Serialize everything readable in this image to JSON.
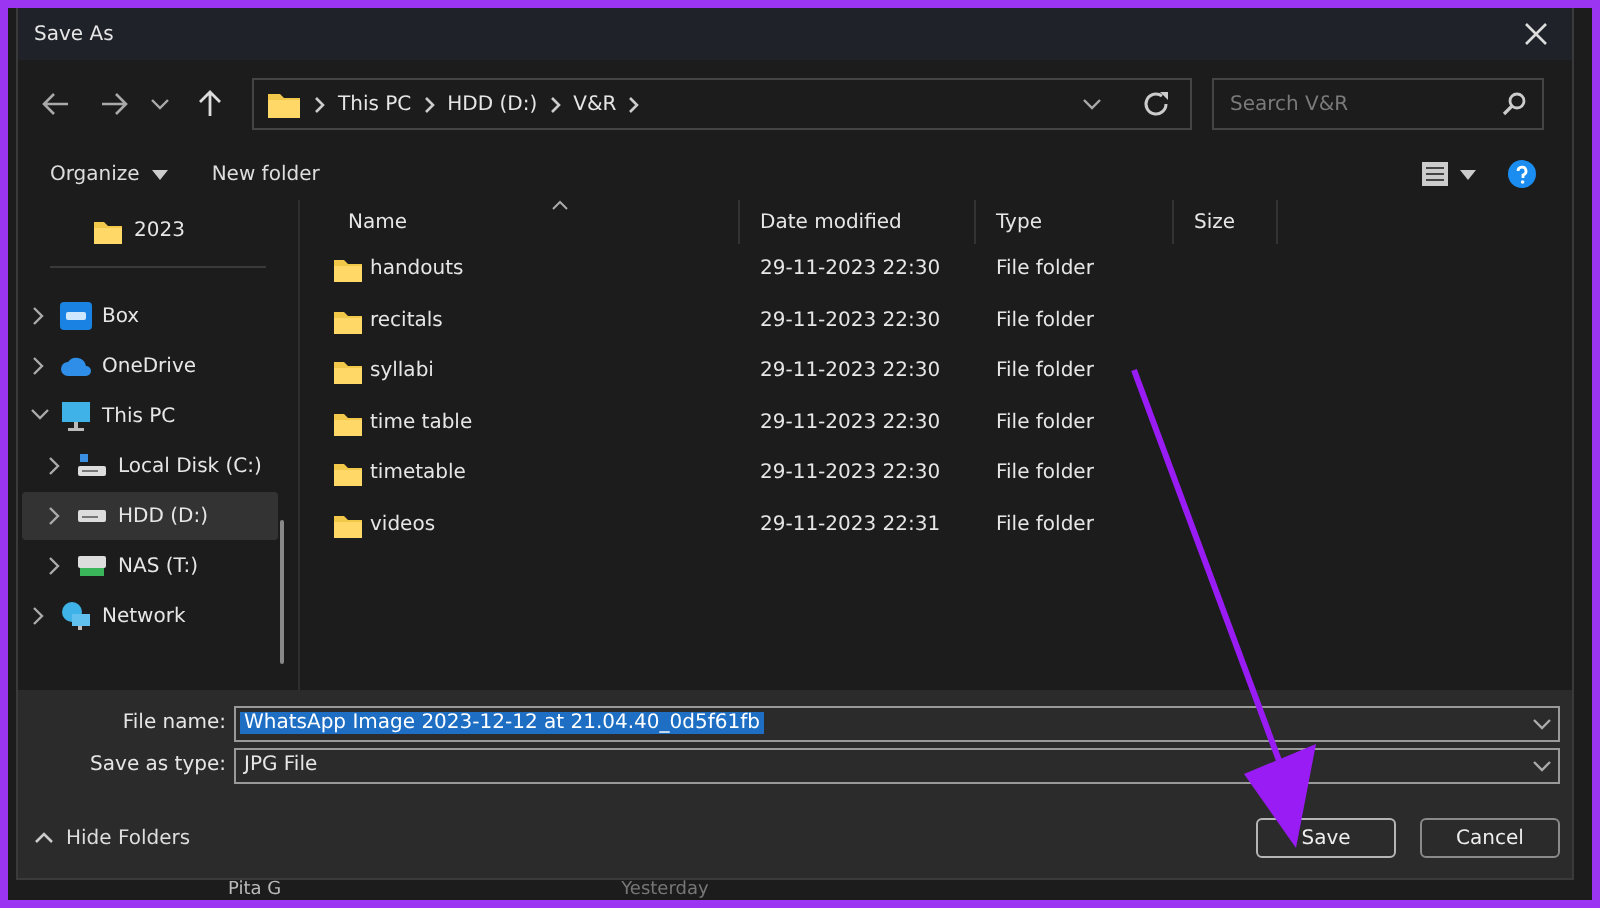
{
  "window": {
    "title": "Save As"
  },
  "address": {
    "path": [
      "This PC",
      "HDD (D:)",
      "V&R"
    ]
  },
  "search": {
    "placeholder": "Search V&R"
  },
  "toolbar": {
    "organize": "Organize",
    "new_folder": "New folder"
  },
  "sidebar": {
    "items": [
      {
        "label": "2023",
        "kind": "folder"
      },
      {
        "label": "Box",
        "kind": "box",
        "expanded": false,
        "selected": false
      },
      {
        "label": "OneDrive",
        "kind": "cloud",
        "expanded": false,
        "selected": false
      },
      {
        "label": "This PC",
        "kind": "pc",
        "expanded": true,
        "selected": false,
        "children": [
          {
            "label": "Local Disk (C:)",
            "kind": "disk",
            "expanded": false,
            "selected": false
          },
          {
            "label": "HDD (D:)",
            "kind": "drive",
            "expanded": false,
            "selected": true
          },
          {
            "label": "NAS (T:)",
            "kind": "nas",
            "expanded": false,
            "selected": false
          }
        ]
      },
      {
        "label": "Network",
        "kind": "network",
        "expanded": false,
        "selected": false
      }
    ]
  },
  "table": {
    "columns": [
      "Name",
      "Date modified",
      "Type",
      "Size"
    ],
    "rows": [
      {
        "name": "handouts",
        "date": "29-11-2023 22:30",
        "type": "File folder"
      },
      {
        "name": "recitals",
        "date": "29-11-2023 22:30",
        "type": "File folder"
      },
      {
        "name": "syllabi",
        "date": "29-11-2023 22:30",
        "type": "File folder"
      },
      {
        "name": "time table",
        "date": "29-11-2023 22:30",
        "type": "File folder"
      },
      {
        "name": "timetable",
        "date": "29-11-2023 22:30",
        "type": "File folder"
      },
      {
        "name": "videos",
        "date": "29-11-2023 22:31",
        "type": "File folder"
      }
    ]
  },
  "form": {
    "file_name_label": "File name:",
    "file_name": "WhatsApp Image 2023-12-12 at 21.04.40_0d5f61fb",
    "type_label": "Save as type:",
    "type": "JPG File"
  },
  "hide_folders": "Hide Folders",
  "buttons": [
    "Save",
    "Cancel"
  ],
  "background": {
    "name": "Pita G",
    "time": "Yesterday"
  }
}
